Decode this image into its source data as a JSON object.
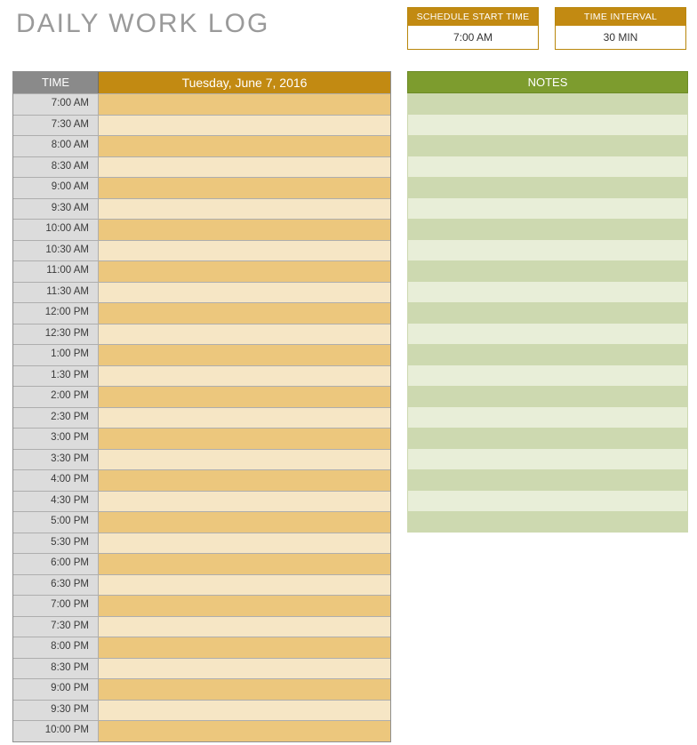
{
  "title": "DAILY WORK LOG",
  "controls": {
    "start_time": {
      "label": "SCHEDULE START TIME",
      "value": "7:00 AM"
    },
    "interval": {
      "label": "TIME INTERVAL",
      "value": "30 MIN"
    }
  },
  "schedule": {
    "time_header": "TIME",
    "date_header": "Tuesday, June 7, 2016",
    "rows": [
      {
        "time": "7:00 AM",
        "entry": ""
      },
      {
        "time": "7:30 AM",
        "entry": ""
      },
      {
        "time": "8:00 AM",
        "entry": ""
      },
      {
        "time": "8:30 AM",
        "entry": ""
      },
      {
        "time": "9:00 AM",
        "entry": ""
      },
      {
        "time": "9:30 AM",
        "entry": ""
      },
      {
        "time": "10:00 AM",
        "entry": ""
      },
      {
        "time": "10:30 AM",
        "entry": ""
      },
      {
        "time": "11:00 AM",
        "entry": ""
      },
      {
        "time": "11:30 AM",
        "entry": ""
      },
      {
        "time": "12:00 PM",
        "entry": ""
      },
      {
        "time": "12:30 PM",
        "entry": ""
      },
      {
        "time": "1:00 PM",
        "entry": ""
      },
      {
        "time": "1:30 PM",
        "entry": ""
      },
      {
        "time": "2:00 PM",
        "entry": ""
      },
      {
        "time": "2:30 PM",
        "entry": ""
      },
      {
        "time": "3:00 PM",
        "entry": ""
      },
      {
        "time": "3:30 PM",
        "entry": ""
      },
      {
        "time": "4:00 PM",
        "entry": ""
      },
      {
        "time": "4:30 PM",
        "entry": ""
      },
      {
        "time": "5:00 PM",
        "entry": ""
      },
      {
        "time": "5:30 PM",
        "entry": ""
      },
      {
        "time": "6:00 PM",
        "entry": ""
      },
      {
        "time": "6:30 PM",
        "entry": ""
      },
      {
        "time": "7:00 PM",
        "entry": ""
      },
      {
        "time": "7:30 PM",
        "entry": ""
      },
      {
        "time": "8:00 PM",
        "entry": ""
      },
      {
        "time": "8:30 PM",
        "entry": ""
      },
      {
        "time": "9:00 PM",
        "entry": ""
      },
      {
        "time": "9:30 PM",
        "entry": ""
      },
      {
        "time": "10:00 PM",
        "entry": ""
      }
    ]
  },
  "notes": {
    "header": "NOTES",
    "row_count": 21
  }
}
